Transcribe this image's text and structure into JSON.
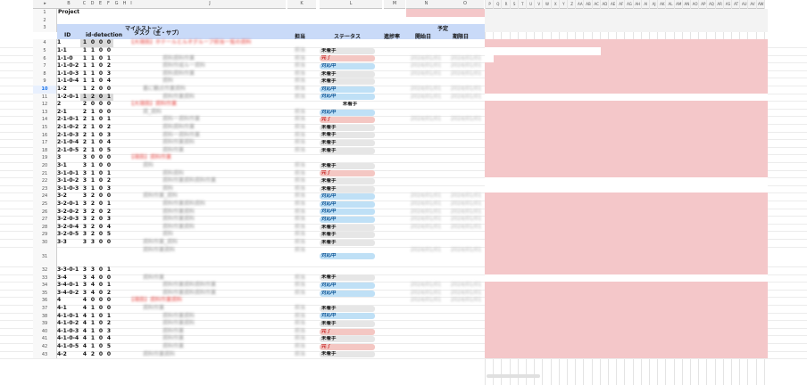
{
  "columns": {
    "left": [
      "▸",
      "B",
      "C",
      "D",
      "E",
      "F",
      "G",
      "H",
      "I",
      "J",
      "K",
      "L",
      "M",
      "N",
      "O"
    ],
    "right": [
      "P",
      "Q",
      "R",
      "S",
      "T",
      "U",
      "V",
      "W",
      "X",
      "Y",
      "Z",
      "AA",
      "AB",
      "AC",
      "AD",
      "AE",
      "AF",
      "AG",
      "AH",
      "AI",
      "AJ",
      "AK",
      "AL",
      "AM",
      "AN",
      "AO",
      "AP",
      "AQ",
      "AR",
      "AS",
      "AT",
      "AU",
      "AV",
      "AW"
    ]
  },
  "header": {
    "project": "Project",
    "milestone": "マイルストーン",
    "task": "タスク（主・サブ）",
    "id": "ID",
    "id_detection": "id-detection",
    "tanto": "担当",
    "status": "ステータス",
    "progress": "進捗率",
    "yotei": "予定",
    "start": "開始日",
    "end": "期限日"
  },
  "rows": [
    {
      "n": "4",
      "id": "1",
      "d": [
        "1",
        "0",
        "0",
        "0"
      ],
      "task": "【大項目】ホテールとルオグループ担当一覧の資料",
      "status": ""
    },
    {
      "n": "5",
      "id": "1-1",
      "d": [
        "1",
        "1",
        "0",
        "0"
      ],
      "task": "",
      "status": "未着手"
    },
    {
      "n": "6",
      "id": "1-1-0",
      "d": [
        "1",
        "1",
        "0",
        "1"
      ],
      "task": "資料資料作業",
      "status": "完了"
    },
    {
      "n": "7",
      "id": "1-1-0-2",
      "d": [
        "1",
        "1",
        "0",
        "2"
      ],
      "task": "資料作成ル一資料",
      "status": "対応中"
    },
    {
      "n": "8",
      "id": "1-1-0-3",
      "d": [
        "1",
        "1",
        "0",
        "3"
      ],
      "task": "資料資料作業",
      "status": "未着手"
    },
    {
      "n": "9",
      "id": "1-1-0-4",
      "d": [
        "1",
        "1",
        "0",
        "4"
      ],
      "task": "資料",
      "status": "未着手"
    },
    {
      "n": "10",
      "id": "1-2",
      "d": [
        "1",
        "2",
        "0",
        "0"
      ],
      "task": "基に観点作業資料",
      "status": "対応中"
    },
    {
      "n": "11",
      "id": "1-2-0-1",
      "d": [
        "1",
        "2",
        "0",
        "1"
      ],
      "task": "資料作業資料",
      "status": "対応中"
    },
    {
      "n": "12",
      "id": "2",
      "d": [
        "2",
        "0",
        "0",
        "0"
      ],
      "task": "【大項目】資料作業",
      "status": "未着手"
    },
    {
      "n": "13",
      "id": "2-1",
      "d": [
        "2",
        "1",
        "0",
        "0"
      ],
      "task": "資_資料",
      "status": "対応中"
    },
    {
      "n": "14",
      "id": "2-1-0-1",
      "d": [
        "2",
        "1",
        "0",
        "1"
      ],
      "task": "資料ー資料作業",
      "status": "完了"
    },
    {
      "n": "15",
      "id": "2-1-0-2",
      "d": [
        "2",
        "1",
        "0",
        "2"
      ],
      "task": "資料資料作業",
      "status": "未着手"
    },
    {
      "n": "16",
      "id": "2-1-0-3",
      "d": [
        "2",
        "1",
        "0",
        "3"
      ],
      "task": "資料ー資料作業",
      "status": "未着手"
    },
    {
      "n": "17",
      "id": "2-1-0-4",
      "d": [
        "2",
        "1",
        "0",
        "4"
      ],
      "task": "資料作業資料",
      "status": "未着手"
    },
    {
      "n": "18",
      "id": "2-1-0-5",
      "d": [
        "2",
        "1",
        "0",
        "5"
      ],
      "task": "資料作業",
      "status": "未着手"
    },
    {
      "n": "19",
      "id": "3",
      "d": [
        "3",
        "0",
        "0",
        "0"
      ],
      "task": "【項目】資料作業",
      "status": ""
    },
    {
      "n": "20",
      "id": "3-1",
      "d": [
        "3",
        "1",
        "0",
        "0"
      ],
      "task": "資料",
      "status": "未着手"
    },
    {
      "n": "21",
      "id": "3-1-0-1",
      "d": [
        "3",
        "1",
        "0",
        "1"
      ],
      "task": "資料資料",
      "status": "完了"
    },
    {
      "n": "22",
      "id": "3-1-0-2",
      "d": [
        "3",
        "1",
        "0",
        "2"
      ],
      "task": "資料作業資料資料作業",
      "status": "未着手"
    },
    {
      "n": "23",
      "id": "3-1-0-3",
      "d": [
        "3",
        "1",
        "0",
        "3"
      ],
      "task": "資料",
      "status": "未着手"
    },
    {
      "n": "24",
      "id": "3-2",
      "d": [
        "3",
        "2",
        "0",
        "0"
      ],
      "task": "資料作業_資料",
      "status": "対応中"
    },
    {
      "n": "25",
      "id": "3-2-0-1",
      "d": [
        "3",
        "2",
        "0",
        "1"
      ],
      "task": "資料作業資料資料",
      "status": "対応中"
    },
    {
      "n": "26",
      "id": "3-2-0-2",
      "d": [
        "3",
        "2",
        "0",
        "2"
      ],
      "task": "資料作業資料",
      "status": "対応中"
    },
    {
      "n": "27",
      "id": "3-2-0-3",
      "d": [
        "3",
        "2",
        "0",
        "3"
      ],
      "task": "資料作業資料",
      "status": "対応中"
    },
    {
      "n": "28",
      "id": "3-2-0-4",
      "d": [
        "3",
        "2",
        "0",
        "4"
      ],
      "task": "資料作業資料",
      "status": "未着手"
    },
    {
      "n": "29",
      "id": "3-2-0-5",
      "d": [
        "3",
        "2",
        "0",
        "5"
      ],
      "task": "資料",
      "status": "未着手"
    },
    {
      "n": "30",
      "id": "3-3",
      "d": [
        "3",
        "3",
        "0",
        "0"
      ],
      "task": "資料作業_資料",
      "status": "未着手"
    },
    {
      "n": "31",
      "id": "",
      "d": [
        "",
        "",
        "",
        ""
      ],
      "task": "資料作業資料",
      "status": "対応中",
      "tall": true
    },
    {
      "n": "32",
      "id": "3-3-0-1",
      "d": [
        "3",
        "3",
        "0",
        "1"
      ],
      "task": "",
      "status": ""
    },
    {
      "n": "33",
      "id": "3-4",
      "d": [
        "3",
        "4",
        "0",
        "0"
      ],
      "task": "資料作業",
      "status": "未着手"
    },
    {
      "n": "34",
      "id": "3-4-0-1",
      "d": [
        "3",
        "4",
        "0",
        "1"
      ],
      "task": "資料作業資料資料作業",
      "status": "対応中"
    },
    {
      "n": "35",
      "id": "3-4-0-2",
      "d": [
        "3",
        "4",
        "0",
        "2"
      ],
      "task": "資料作業資料資料作業",
      "status": "対応中"
    },
    {
      "n": "36",
      "id": "4",
      "d": [
        "4",
        "0",
        "0",
        "0"
      ],
      "task": "【項目】資料作業資料",
      "status": ""
    },
    {
      "n": "37",
      "id": "4-1",
      "d": [
        "4",
        "1",
        "0",
        "0"
      ],
      "task": "資料作業",
      "status": "未着手"
    },
    {
      "n": "38",
      "id": "4-1-0-1",
      "d": [
        "4",
        "1",
        "0",
        "1"
      ],
      "task": "資料作業資料",
      "status": "対応中"
    },
    {
      "n": "39",
      "id": "4-1-0-2",
      "d": [
        "4",
        "1",
        "0",
        "2"
      ],
      "task": "資料作業資料",
      "status": "未着手"
    },
    {
      "n": "40",
      "id": "4-1-0-3",
      "d": [
        "4",
        "1",
        "0",
        "3"
      ],
      "task": "資料作業",
      "status": "完了"
    },
    {
      "n": "41",
      "id": "4-1-0-4",
      "d": [
        "4",
        "1",
        "0",
        "4"
      ],
      "task": "資料作業",
      "status": "未着手"
    },
    {
      "n": "42",
      "id": "4-1-0-5",
      "d": [
        "4",
        "1",
        "0",
        "5"
      ],
      "task": "資料作業",
      "status": "完了"
    },
    {
      "n": "43",
      "id": "4-2",
      "d": [
        "4",
        "2",
        "0",
        "0"
      ],
      "task": "資料作業資料",
      "status": "未着手"
    }
  ],
  "colors": {
    "pink": "#f4c7c9",
    "done": "#f4c7c3",
    "doing": "#bfe0f6",
    "pending": "#e6e6e6",
    "header": "#c9daf8"
  }
}
